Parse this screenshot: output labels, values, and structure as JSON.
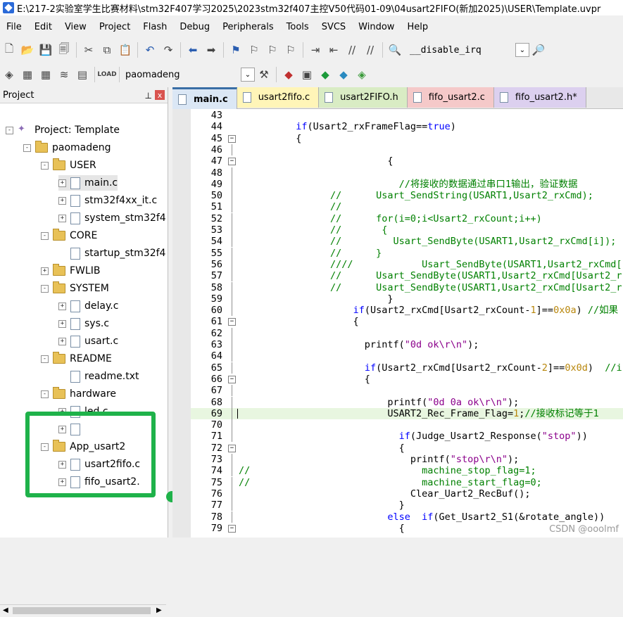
{
  "window": {
    "title": "E:\\217-2实验室学生比赛材料\\stm32F407学习2025\\2023stm32f407主控V50代码01-09\\04usart2FIFO(新加2025)\\USER\\Template.uvpr"
  },
  "menu": [
    "File",
    "Edit",
    "View",
    "Project",
    "Flash",
    "Debug",
    "Peripherals",
    "Tools",
    "SVCS",
    "Window",
    "Help"
  ],
  "toolbar1": {
    "find_text": "__disable_irq"
  },
  "toolbar2": {
    "target": "paomadeng"
  },
  "project_panel": {
    "title": "Project",
    "close_label": "x",
    "pin_label": "ᅟ",
    "tree": [
      {
        "label": "Project: Template",
        "type": "project",
        "level": 0,
        "exp": "-"
      },
      {
        "label": "paomadeng",
        "type": "folder",
        "level": 1,
        "exp": "-"
      },
      {
        "label": "USER",
        "type": "folder",
        "level": 2,
        "exp": "-"
      },
      {
        "label": "main.c",
        "type": "file",
        "level": 3,
        "exp": "+"
      },
      {
        "label": "stm32f4xx_it.c",
        "type": "file",
        "level": 3,
        "exp": "+"
      },
      {
        "label": "system_stm32f4",
        "type": "file",
        "level": 3,
        "exp": "+"
      },
      {
        "label": "CORE",
        "type": "folder",
        "level": 2,
        "exp": "-"
      },
      {
        "label": "startup_stm32f4",
        "type": "file",
        "level": 3,
        "exp": ""
      },
      {
        "label": "FWLIB",
        "type": "folder",
        "level": 2,
        "exp": "+"
      },
      {
        "label": "SYSTEM",
        "type": "folder",
        "level": 2,
        "exp": "-"
      },
      {
        "label": "delay.c",
        "type": "file",
        "level": 3,
        "exp": "+"
      },
      {
        "label": "sys.c",
        "type": "file",
        "level": 3,
        "exp": "+"
      },
      {
        "label": "usart.c",
        "type": "file",
        "level": 3,
        "exp": "+"
      },
      {
        "label": "README",
        "type": "folder",
        "level": 2,
        "exp": "-"
      },
      {
        "label": "readme.txt",
        "type": "file",
        "level": 3,
        "exp": ""
      },
      {
        "label": "hardware",
        "type": "folder",
        "level": 2,
        "exp": "-"
      },
      {
        "label": "led.c",
        "type": "file",
        "level": 3,
        "exp": "+"
      },
      {
        "label": "",
        "type": "file",
        "level": 3,
        "exp": "+"
      },
      {
        "label": "App_usart2",
        "type": "folder",
        "level": 2,
        "exp": "-"
      },
      {
        "label": "usart2fifo.c",
        "type": "file",
        "level": 3,
        "exp": "+"
      },
      {
        "label": "fifo_usart2.",
        "type": "file",
        "level": 3,
        "exp": "+"
      }
    ]
  },
  "tabs": [
    {
      "label": "main.c",
      "cls": "tab-main"
    },
    {
      "label": "usart2fifo.c",
      "cls": "tab-usart2fifo"
    },
    {
      "label": "usart2FIFO.h",
      "cls": "tab-usart2FIFOh"
    },
    {
      "label": "fifo_usart2.c",
      "cls": "tab-fifousart2c"
    },
    {
      "label": "fifo_usart2.h*",
      "cls": "tab-fifousart2h"
    }
  ],
  "editor": {
    "current_line": "69",
    "lines": [
      {
        "n": "43",
        "f": "",
        "t": ""
      },
      {
        "n": "44",
        "f": "",
        "t": "          <k>if</k>(Usart2_rxFrameFlag==<k>true</k>)"
      },
      {
        "n": "45",
        "f": "-",
        "t": "          {"
      },
      {
        "n": "46",
        "f": "|",
        "t": ""
      },
      {
        "n": "47",
        "f": "-",
        "t": "                          {"
      },
      {
        "n": "48",
        "f": "|",
        "t": ""
      },
      {
        "n": "49",
        "f": "|",
        "t": "                            <c>//将接收的数据通过串口1输出，验证数据</c>"
      },
      {
        "n": "50",
        "f": "|",
        "t": "<c>                //      Usart_SendString(USART1,Usart2_rxCmd);</c>"
      },
      {
        "n": "51",
        "f": "|",
        "t": "<c>                //</c>"
      },
      {
        "n": "52",
        "f": "|",
        "t": "<c>                //      for(i=0;i&lt;Usart2_rxCount;i++)</c>"
      },
      {
        "n": "53",
        "f": "|",
        "t": "<c>                //       {</c>"
      },
      {
        "n": "54",
        "f": "|",
        "t": "<c>                //         Usart_SendByte(USART1,Usart2_rxCmd[i]);</c>"
      },
      {
        "n": "55",
        "f": "|",
        "t": "<c>                //      }</c>"
      },
      {
        "n": "56",
        "f": "|",
        "t": "<c>                ////            Usart_SendByte(USART1,Usart2_rxCmd[</c>"
      },
      {
        "n": "57",
        "f": "|",
        "t": "<c>                //      Usart_SendByte(USART1,Usart2_rxCmd[Usart2_r</c>"
      },
      {
        "n": "58",
        "f": "|",
        "t": "<c>                //      Usart_SendByte(USART1,Usart2_rxCmd[Usart2_r</c>"
      },
      {
        "n": "59",
        "f": "|",
        "t": "                          }"
      },
      {
        "n": "60",
        "f": "|",
        "t": "                    <k>if</k>(Usart2_rxCmd[Usart2_rxCount-<n>1</n>]==<n>0x0a</n>) <c>//如果</c>"
      },
      {
        "n": "61",
        "f": "-",
        "t": "                    {"
      },
      {
        "n": "62",
        "f": "|",
        "t": ""
      },
      {
        "n": "63",
        "f": "|",
        "t": "                      printf(<s>\"0d ok\\r\\n\"</s>);"
      },
      {
        "n": "64",
        "f": "|",
        "t": ""
      },
      {
        "n": "65",
        "f": "|",
        "t": "                      <k>if</k>(Usart2_rxCmd[Usart2_rxCount-<n>2</n>]==<n>0x0d</n>)  <c>//i</c>"
      },
      {
        "n": "66",
        "f": "-",
        "t": "                      {"
      },
      {
        "n": "67",
        "f": "|",
        "t": ""
      },
      {
        "n": "68",
        "f": "|",
        "t": "                          printf(<s>\"0d 0a ok\\r\\n\"</s>);"
      },
      {
        "n": "69",
        "f": "|",
        "t": "                          USART2_Rec_Frame_Flag=<n>1</n>;<c>//接收标记等于1</c>"
      },
      {
        "n": "70",
        "f": "|",
        "t": ""
      },
      {
        "n": "71",
        "f": "|",
        "t": "                            <k>if</k>(Judge_Usart2_Response(<s>\"stop\"</s>))"
      },
      {
        "n": "72",
        "f": "-",
        "t": "                            {"
      },
      {
        "n": "73",
        "f": "|",
        "t": "                              printf(<s>\"stop\\r\\n\"</s>);"
      },
      {
        "n": "74",
        "f": "|",
        "t": "<c>//                              machine_stop_flag=1;</c>"
      },
      {
        "n": "75",
        "f": "|",
        "t": "<c>//                              machine_start_flag=0;</c>"
      },
      {
        "n": "76",
        "f": "|",
        "t": "                              Clear_Uart2_RecBuf();"
      },
      {
        "n": "77",
        "f": "|",
        "t": "                            }"
      },
      {
        "n": "78",
        "f": "|",
        "t": "                          <k>else</k>  <k>if</k>(Get_Usart2_S1(&amp;rotate_angle))"
      },
      {
        "n": "79",
        "f": "-",
        "t": "                            {"
      }
    ]
  },
  "watermark": "CSDN @ooolmf"
}
